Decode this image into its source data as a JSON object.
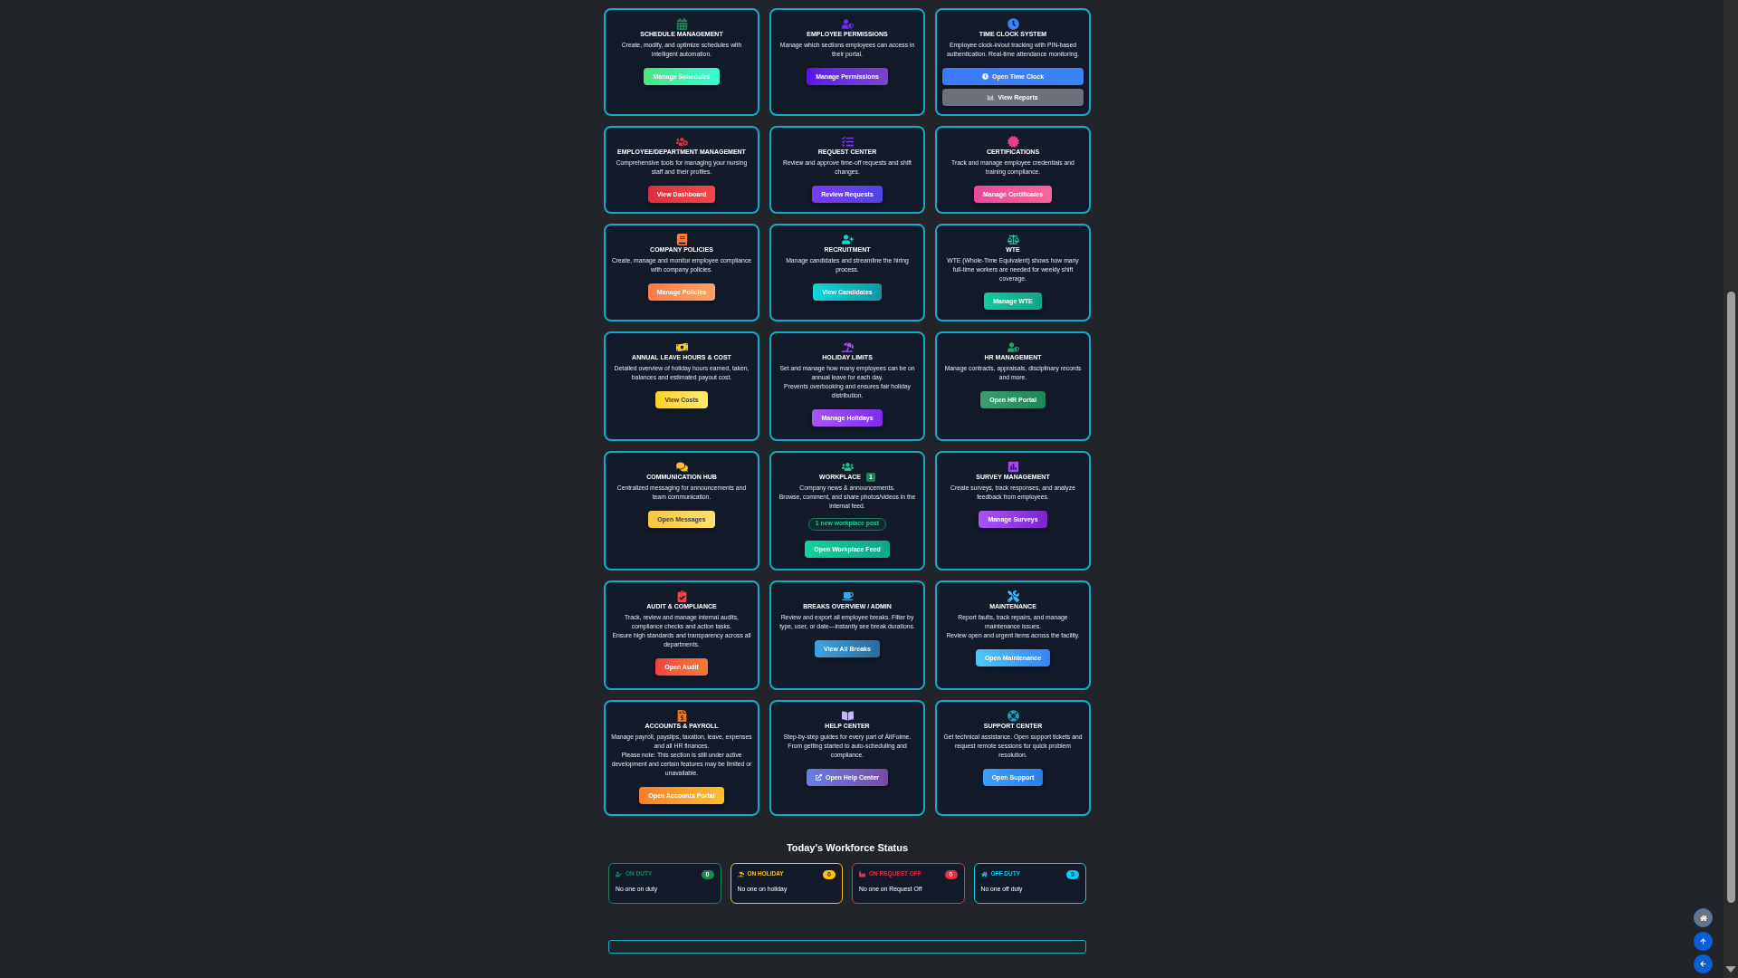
{
  "cards": [
    {
      "title": "SCHEDULE MANAGEMENT",
      "color": "#198754",
      "description": [
        "Create, modify, and optimize schedules with intelligent automation."
      ],
      "buttons": [
        "Manage Schedules"
      ]
    },
    {
      "title": "EMPLOYEE PERMISSIONS",
      "color": "#6f2cf5",
      "description": [
        "Manage which sections employees can access in their portal."
      ],
      "buttons": [
        "Manage Permissions"
      ]
    },
    {
      "title": "TIME CLOCK SYSTEM",
      "color": "#3b82f6",
      "description": [
        "Employee clock-in/out tracking with PIN-based authentication. Real-time attendance monitoring."
      ],
      "buttons": [
        "Open Time Clock",
        "View Reports"
      ]
    },
    {
      "title": "EMPLOYEE/DEPARTMENT MANAGEMENT",
      "color": "#dc3545",
      "description": [
        "Comprehensive tools for managing your nursing staff and their profiles."
      ],
      "buttons": [
        "View Dashboard"
      ]
    },
    {
      "title": "REQUEST CENTER",
      "color": "#7c3aed",
      "description": [
        "Review and approve time-off requests and shift changes."
      ],
      "buttons": [
        "Review Requests"
      ]
    },
    {
      "title": "CERTIFICATIONS",
      "color": "#e83e8c",
      "description": [
        "Track and manage employee credentials and training compliance."
      ],
      "buttons": [
        "Manage Certificates"
      ]
    },
    {
      "title": "COMPANY POLICIES",
      "color": "#fd7e45",
      "description": [
        "Create, manage and monitor employee compliance with company policies."
      ],
      "buttons": [
        "Manage Policies"
      ]
    },
    {
      "title": "RECRUITMENT",
      "color": "#1fd1c1",
      "description": [
        "Manage candidates and streamline the hiring process."
      ],
      "buttons": [
        "View Candidates"
      ]
    },
    {
      "title": "WTE",
      "color": "#20c997",
      "description": [
        "WTE (Whole-Time Equivalent) shows how many full-time workers are needed for weekly shift coverage."
      ],
      "buttons": [
        "Manage WTE"
      ]
    },
    {
      "title": "ANNUAL LEAVE HOURS & COST",
      "color": "#facc15",
      "description": [
        "Detailed overview of holiday hours earned, taken, balances and estimated payout cost."
      ],
      "buttons": [
        "View Costs"
      ]
    },
    {
      "title": "HOLIDAY LIMITS",
      "color": "#a855f7",
      "description": [
        "Set and manage how many employees can be on annual leave for each day.",
        "Prevents overbooking and ensures fair holiday distribution."
      ],
      "buttons": [
        "Manage Holidays"
      ]
    },
    {
      "title": "HR MANAGEMENT",
      "color": "#2f9e70",
      "description": [
        "Manage contracts, appraisals, disciplinary records and more."
      ],
      "buttons": [
        "Open HR Portal"
      ]
    },
    {
      "title": "COMMUNICATION HUB",
      "color": "#fbbf24",
      "description": [
        "Centralized messaging for announcements and team communication."
      ],
      "buttons": [
        "Open Messages"
      ]
    },
    {
      "title": "WORKPLACE",
      "title_badge": "1",
      "color": "#10c995",
      "description": [
        "Company news & announcements.",
        "Browse, comment, and share photos/videos in the internal feed."
      ],
      "notice": "1 new workplace post",
      "buttons": [
        "Open Workplace Feed"
      ]
    },
    {
      "title": "SURVEY MANAGEMENT",
      "color": "#a04be8",
      "description": [
        "Create surveys, track responses, and analyze feedback from employees."
      ],
      "buttons": [
        "Manage Surveys"
      ]
    },
    {
      "title": "AUDIT & COMPLIANCE",
      "color": "#ef4444",
      "description": [
        "Track, review and manage internal audits, compliance checks and action tasks.",
        "Ensure high standards and transparency across all departments."
      ],
      "buttons": [
        "Open Audit"
      ]
    },
    {
      "title": "BREAKS OVERVIEW / ADMIN",
      "color": "#38a9e0",
      "description": [
        "Review and export all employee breaks. Filter by type, user, or date—instantly see break durations."
      ],
      "buttons": [
        "View All Breaks"
      ]
    },
    {
      "title": "MAINTENANCE",
      "color": "#38bdf8",
      "description": [
        "Report faults, track repairs, and manage maintenance issues.",
        "Review open and urgent items across the facility."
      ],
      "buttons": [
        "Open Maintenance"
      ]
    },
    {
      "title": "ACCOUNTS & PAYROLL",
      "color": "#f97316",
      "description": [
        "Manage payroll, payslips, taxation, leave, expenses and all HR finances.",
        "Please note: This section is still under active development and certain features may be limited or unavailable."
      ],
      "buttons": [
        "Open Accounts Portal"
      ]
    },
    {
      "title": "HELP CENTER",
      "color": "#c4b5fd",
      "description": [
        "Step-by-step guides for every part of ÁltFoime.",
        "From getting started to auto-scheduling and compliance."
      ],
      "buttons": [
        "Open Help Center"
      ]
    },
    {
      "title": "SUPPORT CENTER",
      "color": "#17a2b8",
      "description": [
        "Get technical assistance. Open support tickets and request remote sessions for quick problem resolution."
      ],
      "buttons": [
        "Open Support"
      ]
    }
  ],
  "workforce_status": {
    "title": "Today's Workforce Status",
    "items": [
      {
        "label": "ON DUTY",
        "count": "0",
        "message": "No one on duty",
        "color": "#198754"
      },
      {
        "label": "ON HOLIDAY",
        "count": "0",
        "message": "No one on holiday",
        "color": "#ffc107"
      },
      {
        "label": "ON REQUEST OFF",
        "count": "0",
        "message": "No one on Request Off",
        "color": "#dc3545"
      },
      {
        "label": "OFF DUTY",
        "count": "0",
        "message": "No one off duty",
        "color": "#0dcaf0"
      }
    ]
  }
}
